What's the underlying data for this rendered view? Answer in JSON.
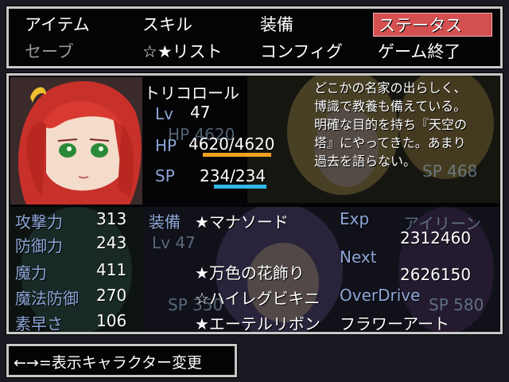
{
  "menu": {
    "items": [
      {
        "label": "アイテム"
      },
      {
        "label": "スキル"
      },
      {
        "label": "装備"
      },
      {
        "label": "ステータス"
      },
      {
        "label": "セーブ"
      },
      {
        "label": "☆★リスト"
      },
      {
        "label": "コンフィグ"
      },
      {
        "label": "ゲーム終了"
      }
    ],
    "selected": "ステータス"
  },
  "character": {
    "name": "トリコロール",
    "lv_label": "Lv",
    "lv": "47",
    "hp_label": "HP",
    "hp": "4620/4620",
    "hp_ratio": 1.0,
    "sp_label": "SP",
    "sp": "234/234",
    "sp_ratio": 1.0,
    "description": [
      "どこかの名家の出らしく、",
      "博識で教養も備えている。",
      "明確な目的を持ち『天空の",
      "塔』にやってきた。あまり",
      "過去を語らない。"
    ]
  },
  "stats": [
    {
      "label": "攻撃力",
      "value": "313"
    },
    {
      "label": "防御力",
      "value": "243"
    },
    {
      "label": "魔力",
      "value": "411"
    },
    {
      "label": "魔法防御",
      "value": "270"
    },
    {
      "label": "素早さ",
      "value": "106"
    }
  ],
  "equipment": {
    "label": "装備",
    "items": [
      "★マナソード",
      "",
      "★万色の花飾り",
      "☆ハイレグビキニ",
      "★エーテルリボン"
    ]
  },
  "exp": {
    "exp_label": "Exp",
    "exp_value": "2312460",
    "next_label": "Next",
    "next_value": "2626150",
    "overdrive_label": "OverDrive",
    "overdrive_value": "フラワーアート"
  },
  "background_party": {
    "hp_text": "HP 4620",
    "lv_text": "Lv 47",
    "sp_text": "SP 468",
    "name": "アイリーン",
    "sp_text2": "SP 580",
    "sp_text3": "SP 350"
  },
  "hint": "←→=表示キャラクター変更",
  "colors": {
    "label": "#8ea6d8",
    "hp_bar": "#f0a020",
    "sp_bar": "#30b8e8",
    "selected": "#d45050"
  }
}
